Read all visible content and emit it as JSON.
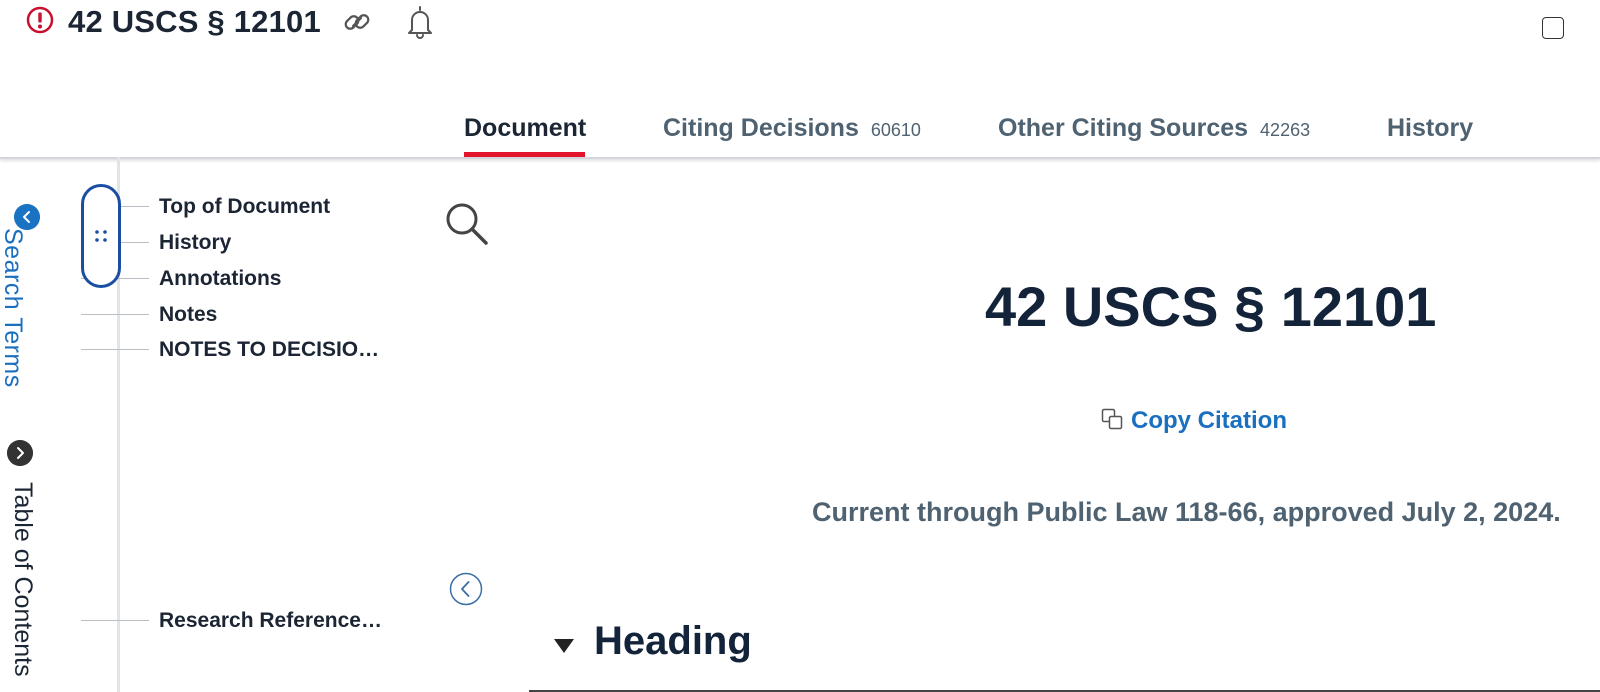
{
  "header": {
    "title": "42 USCS § 12101",
    "icons": [
      "alert-icon",
      "link-icon",
      "bell-icon",
      "checkbox"
    ]
  },
  "tabs": [
    {
      "label": "Document",
      "count": "",
      "active": true
    },
    {
      "label": "Citing Decisions",
      "count": "60610",
      "active": false
    },
    {
      "label": "Other Citing Sources",
      "count": "42263",
      "active": false
    },
    {
      "label": "History",
      "count": "",
      "active": false
    }
  ],
  "rail": {
    "search_terms": "Search Terms",
    "table_of_contents": "Table of Contents"
  },
  "toc": {
    "items": [
      "Top of Document",
      "History",
      "Annotations",
      "Notes",
      "NOTES TO DECISIO…",
      "Research Reference…"
    ]
  },
  "document": {
    "heading": "42 USCS § 12101",
    "copy_citation": "Copy Citation",
    "currency": "Current through Public Law 118-66, approved July 2, 2024.",
    "section_heading": "Heading"
  },
  "colors": {
    "accent_blue": "#1a6fbf",
    "active_tab_underline": "#e3132b",
    "alert_red": "#c8102e",
    "heading_navy": "#13233a",
    "muted_slate": "#4f6271"
  }
}
